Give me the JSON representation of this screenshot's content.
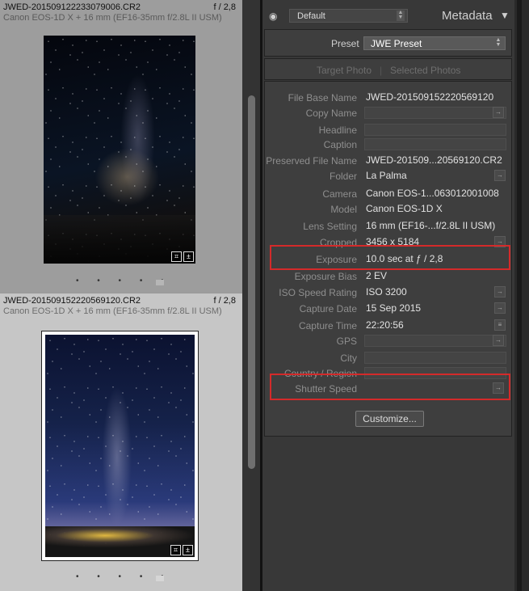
{
  "grid": {
    "cells": [
      {
        "filename": "JWED-201509122233079006.CR2",
        "aperture": "f / 2,8",
        "camera_lens": "Canon EOS-1D X + 16 mm (EF16-35mm f/2.8L II USM)",
        "dots": "• • • • •"
      },
      {
        "filename": "JWED-201509152220569120.CR2",
        "aperture": "f / 2,8",
        "camera_lens": "Canon EOS-1D X + 16 mm (EF16-35mm f/2.8L II USM)",
        "dots": "• • • • •"
      }
    ]
  },
  "panel": {
    "title": "Metadata",
    "view_select": "Default",
    "preset": {
      "label": "Preset",
      "value": "JWE Preset"
    },
    "targets": {
      "target_photo": "Target Photo",
      "separator": "|",
      "selected_photos": "Selected Photos"
    },
    "fields": [
      {
        "label": "File Base Name",
        "value": "JWED-201509152220569120"
      },
      {
        "label": "Copy Name",
        "value": ""
      },
      {
        "label": "Headline",
        "value": ""
      },
      {
        "label": "Caption",
        "value": ""
      },
      {
        "label": "Preserved File Name",
        "value": "JWED-201509...20569120.CR2"
      },
      {
        "label": "Folder",
        "value": "La Palma"
      },
      {
        "label": "Camera",
        "value": "Canon EOS-1...063012001008"
      },
      {
        "label": "Model",
        "value": "Canon EOS-1D X"
      },
      {
        "label": "Lens Setting",
        "value": "16 mm (EF16-...f/2.8L II USM)"
      },
      {
        "label": "Cropped",
        "value": "3456 x 5184"
      },
      {
        "label": "Exposure",
        "value": "10.0 sec at ƒ / 2,8"
      },
      {
        "label": "Exposure Bias",
        "value": "2 EV"
      },
      {
        "label": "ISO Speed Rating",
        "value": "ISO 3200"
      },
      {
        "label": "Capture Date",
        "value": "15 Sep 2015"
      },
      {
        "label": "Capture Time",
        "value": "22:20:56"
      },
      {
        "label": "GPS",
        "value": ""
      },
      {
        "label": "City",
        "value": ""
      },
      {
        "label": "Country / Region",
        "value": ""
      },
      {
        "label": "Shutter Speed",
        "value": ""
      }
    ],
    "customize_label": "Customize..."
  }
}
